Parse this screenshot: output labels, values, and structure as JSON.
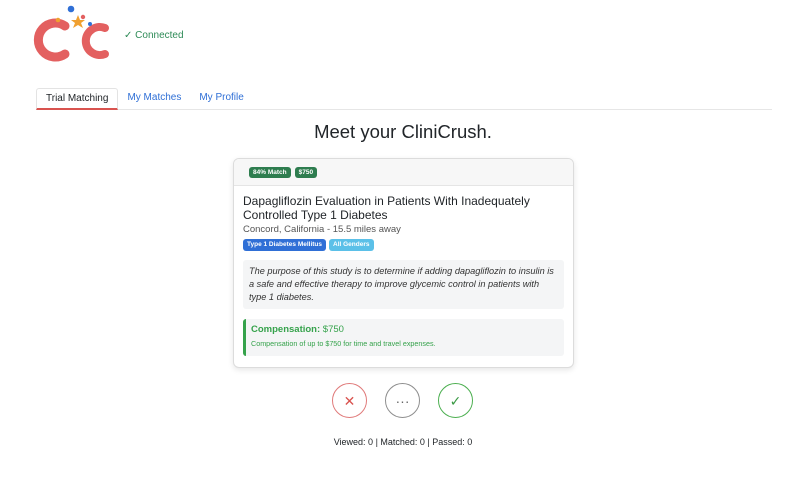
{
  "header": {
    "logo_icon": "cliniCrush-logo",
    "status_icon": "checkmark",
    "status_text": "✓ Connected",
    "status_color": "#2e8b57"
  },
  "tabs": [
    {
      "label": "Trial Matching",
      "active": true
    },
    {
      "label": "My Matches",
      "active": false
    },
    {
      "label": "My Profile",
      "active": false
    }
  ],
  "main": {
    "title": "Meet your CliniCrush."
  },
  "card": {
    "badges": [
      "84% Match",
      "$750"
    ],
    "trial_title": "Dapagliflozin Evaluation in Patients With Inadequately Controlled Type 1 Diabetes",
    "location": "Concord, California - 15.5 miles away",
    "tags": [
      "Type 1 Diabetes Mellitus",
      "All Genders"
    ],
    "description": "The purpose of this study is to determine if adding dapagliflozin to insulin is a safe and effective therapy to improve glycemic control in patients with type 1 diabetes.",
    "compensation": {
      "label": "Compensation:",
      "amount": "$750",
      "detail": "Compensation of up to $750 for time and travel expenses."
    }
  },
  "actions": {
    "reject_icon": "close-x",
    "reject_glyph": "✕",
    "more_icon": "ellipsis",
    "more_glyph": "···",
    "accept_icon": "checkmark",
    "accept_glyph": "✓"
  },
  "stats": "Viewed: 0 | Matched: 0 | Passed: 0",
  "colors": {
    "accent_blue": "#2f6fd6",
    "success_green": "#35a24b",
    "danger_red": "#d9534f",
    "badge_green": "#2e7d4f",
    "info_blue": "#5bc0e8"
  }
}
